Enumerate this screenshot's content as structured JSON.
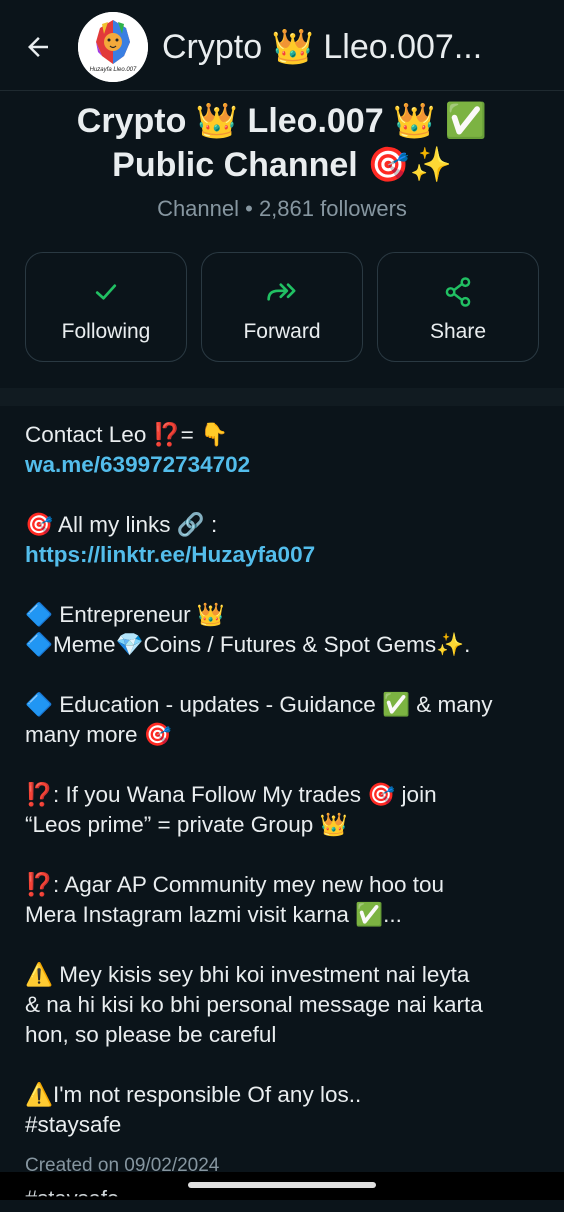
{
  "header": {
    "title": "Crypto 👑 Lleo.007...",
    "avatar_text": "Huzayfa Lleo.007"
  },
  "channel": {
    "name_line1": "Crypto 👑 Lleo.007 👑 ✅",
    "name_line2": "Public Channel 🎯✨",
    "meta": "Channel • 2,861 followers"
  },
  "actions": {
    "following": "Following",
    "forward": "Forward",
    "share": "Share"
  },
  "colors": {
    "accent": "#21c063",
    "link": "#53bdeb",
    "background": "#0b141a"
  },
  "description": {
    "contact_label": "Contact Leo ⁉️= 👇",
    "contact_link": "wa.me/639972734702",
    "links_label": "🎯 All my links 🔗 :",
    "links_url": "https://linktr.ee/Huzayfa007",
    "p3_l1": "🔷 Entrepreneur 👑",
    "p3_l2": "🔷Meme💎Coins / Futures & Spot Gems✨.",
    "p4_l1": "🔷  Education - updates - Guidance ✅ & many",
    "p4_l2": "many more 🎯",
    "p5_l1": "⁉️: If you Wana Follow My trades 🎯 join",
    "p5_l2": "“Leos prime” = private Group 👑",
    "p6_l1": "⁉️: Agar AP Community mey new hoo tou",
    "p6_l2": "Mera Instagram lazmi visit karna ✅...",
    "p7_l1": "⚠️ Mey kisis sey bhi koi investment nai leyta",
    "p7_l2": "& na hi kisi ko bhi personal message nai karta",
    "p7_l3": "hon, so please be careful",
    "p8_l1": "⚠️I'm not responsible Of any los..",
    "p8_l2": "#staysafe"
  },
  "created": "Created on 09/02/2024",
  "peek_text": "#staysafe"
}
